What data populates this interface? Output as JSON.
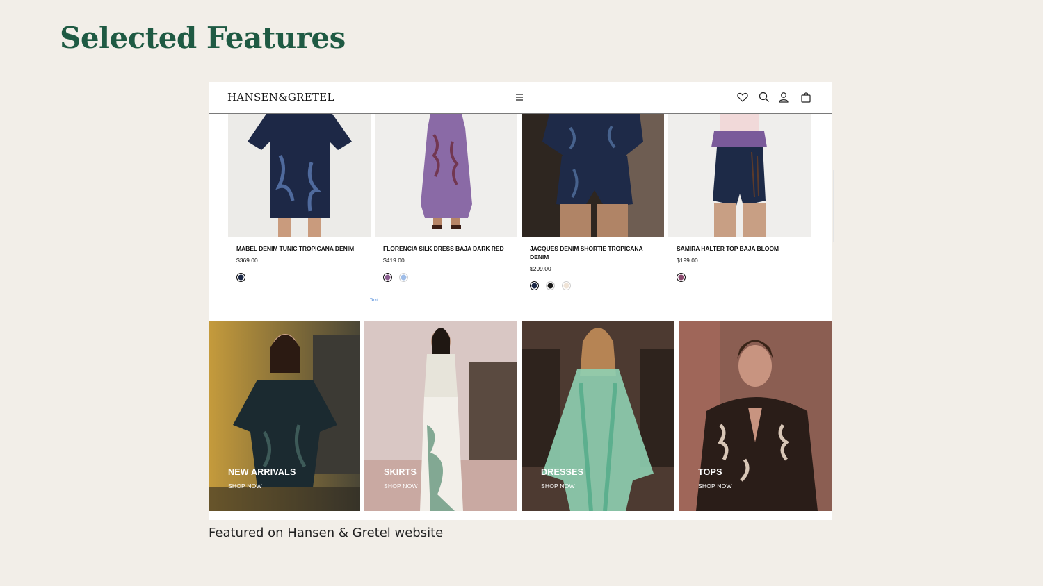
{
  "slide": {
    "title": "Selected Features",
    "caption": "Featured on Hansen & Gretel website"
  },
  "colors": {
    "title_green": "#1f5a43",
    "background": "#f2eee8",
    "link_blue": "#3b7ed6"
  },
  "site": {
    "logo": "HANSEN&GRETEL",
    "header_icons": [
      "menu-icon",
      "heart-icon",
      "search-icon",
      "user-icon",
      "bag-icon"
    ]
  },
  "products": [
    {
      "name": "MABEL DENIM TUNIC TROPICANA DENIM",
      "price": "$369.00",
      "swatches": [
        "#1b2745"
      ]
    },
    {
      "name": "FLORENCIA SILK DRESS BAJA DARK RED",
      "price": "$419.00",
      "swatches": [
        "#8a5d8f",
        "#9fbde8"
      ]
    },
    {
      "name": "JACQUES DENIM SHORTIE TROPICANA DENIM",
      "price": "$299.00",
      "swatches": [
        "#1b2745",
        "#1a1a1a",
        "#efe3d6"
      ]
    },
    {
      "name": "SAMIRA HALTER TOP BAJA BLOOM",
      "price": "$199.00",
      "swatches": [
        "#8a4a6e"
      ]
    }
  ],
  "stray_text": "Text",
  "categories": [
    {
      "title": "NEW ARRIVALS",
      "cta": "SHOP NOW"
    },
    {
      "title": "SKIRTS",
      "cta": "SHOP NOW"
    },
    {
      "title": "DRESSES",
      "cta": "SHOP NOW"
    },
    {
      "title": "TOPS",
      "cta": "SHOP NOW"
    }
  ]
}
